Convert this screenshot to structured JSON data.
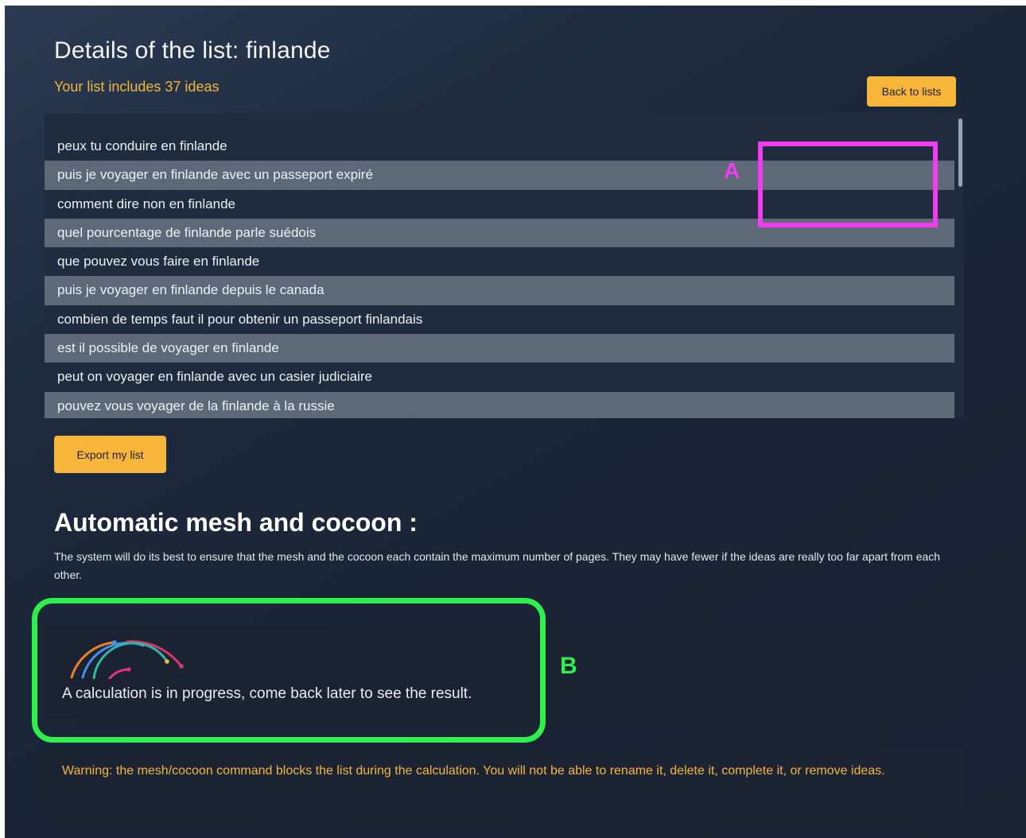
{
  "header": {
    "title": "Details of the list: finlande",
    "subtitle": "Your list includes 37 ideas",
    "back_label": "Back to lists"
  },
  "list": {
    "items": [
      "peux tu conduire en finlande",
      "puis je voyager en finlande avec un passeport expiré",
      "comment dire non en finlande",
      "quel pourcentage de finlande parle suédois",
      "que pouvez vous faire en finlande",
      "puis je voyager en finlande depuis le canada",
      "combien de temps faut il pour obtenir un passeport finlandais",
      "est il possible de voyager en finlande",
      "peut on voyager en finlande avec un casier judiciaire",
      "pouvez vous voyager de la finlande à la russie"
    ]
  },
  "export": {
    "label": "Export my list"
  },
  "mesh": {
    "title": "Automatic mesh and cocoon :",
    "description": "The system will do its best to ensure that the mesh and the cocoon each contain the maximum number of pages. They may have fewer if the ideas are really too far apart from each other.",
    "progress_text": "A calculation is in progress, come back later to see the result.",
    "loader_icon": "progress-arcs-icon",
    "warning": "Warning: the mesh/cocoon command blocks the list during the calculation. You will not be able to rename it, delete it, complete it, or remove ideas."
  },
  "annotations": {
    "a_label": "A",
    "a_color": "#f23cf0",
    "b_label": "B",
    "b_color": "#2ef04d"
  },
  "colors": {
    "accent": "#f7b53a",
    "background": "#1d2a3d"
  }
}
